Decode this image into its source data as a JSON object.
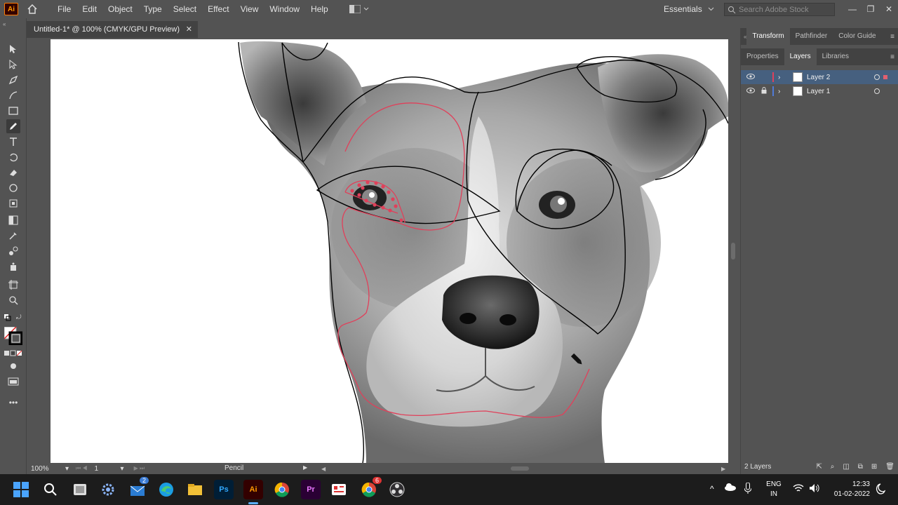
{
  "app": {
    "logo": "Ai"
  },
  "menu": [
    "File",
    "Edit",
    "Object",
    "Type",
    "Select",
    "Effect",
    "View",
    "Window",
    "Help"
  ],
  "workspace": {
    "label": "Essentials"
  },
  "search": {
    "placeholder": "Search Adobe Stock"
  },
  "document": {
    "tab_title": "Untitled-1* @ 100% (CMYK/GPU Preview)"
  },
  "status": {
    "zoom": "100%",
    "page": "1",
    "tool": "Pencil"
  },
  "panels": {
    "top_tabs": [
      "Transform",
      "Pathfinder",
      "Color Guide"
    ],
    "second_tabs": [
      "Properties",
      "Layers",
      "Libraries"
    ],
    "layers": [
      {
        "name": "Layer 2",
        "color": "#e0405a",
        "selected": true,
        "locked": false
      },
      {
        "name": "Layer 1",
        "color": "#4f7bd8",
        "selected": false,
        "locked": true
      }
    ],
    "layer_count": "2 Layers"
  },
  "taskbar": {
    "lang_top": "ENG",
    "lang_bottom": "IN",
    "time": "12:33",
    "date": "01-02-2022",
    "badges": {
      "mail": "2",
      "chrome": "6"
    },
    "app_labels": {
      "photoshop": "Ps",
      "illustrator": "Ai",
      "premiere": "Pr"
    }
  },
  "colors": {
    "accent_selection": "#e0405a",
    "ui_bg": "#535353",
    "panel_dark": "#424242"
  },
  "icons": [
    "home-icon",
    "arrange-documents-icon",
    "search-icon",
    "selection-tool-icon",
    "direct-selection-tool-icon",
    "pen-tool-icon",
    "curvature-tool-icon",
    "rectangle-tool-icon",
    "pencil-tool-icon",
    "type-tool-icon",
    "rotate-tool-icon",
    "eraser-tool-icon",
    "warp-tool-icon",
    "gradient-tool-icon",
    "eyedropper-tool-icon",
    "blend-tool-icon",
    "artboard-tool-icon",
    "zoom-tool-icon"
  ]
}
